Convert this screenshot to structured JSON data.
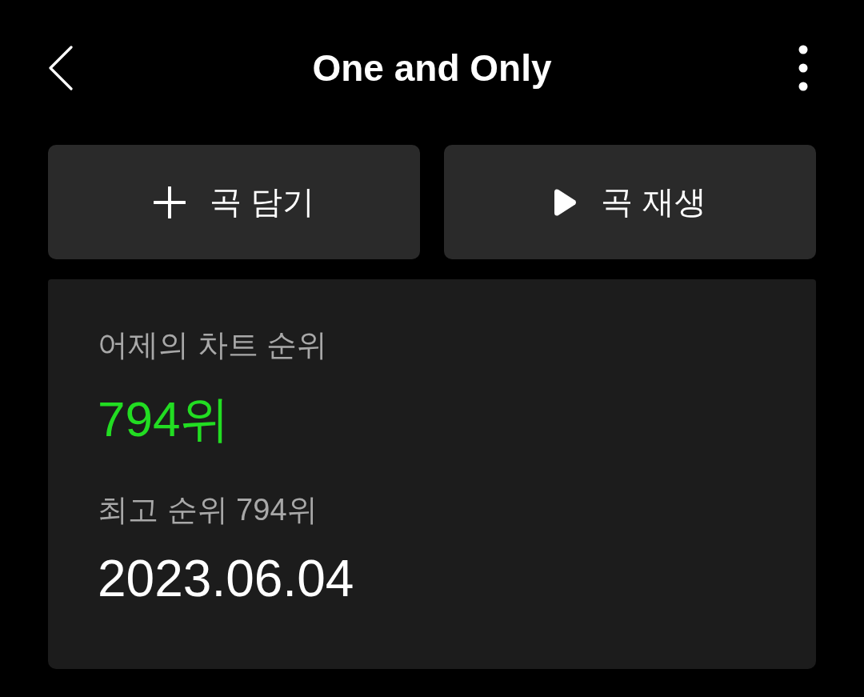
{
  "header": {
    "title": "One and Only"
  },
  "actions": [
    {
      "kind": "add",
      "label": "곡 담기"
    },
    {
      "kind": "play",
      "label": "곡 재생"
    }
  ],
  "chart_rank": {
    "label": "어제의 차트 순위",
    "value": "794위",
    "best_label": "최고 순위 794위",
    "best_date": "2023.06.04"
  }
}
